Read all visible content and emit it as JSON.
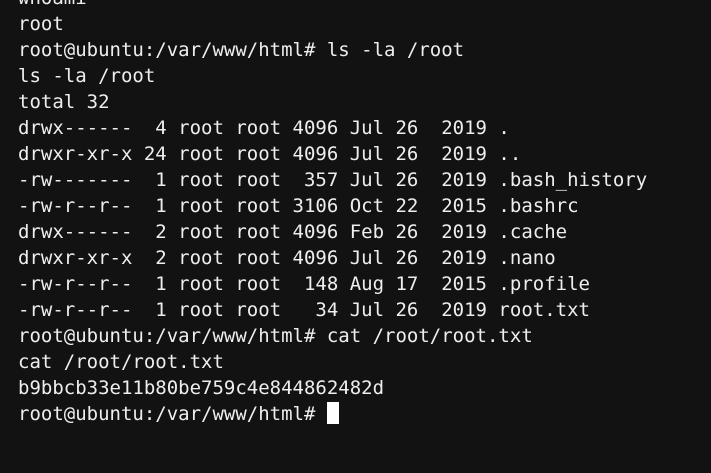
{
  "terminal": {
    "lines": [
      "whoami",
      "root",
      "root@ubuntu:/var/www/html# ls -la /root",
      "ls -la /root",
      "total 32",
      "drwx------  4 root root 4096 Jul 26  2019 .",
      "drwxr-xr-x 24 root root 4096 Jul 26  2019 ..",
      "-rw-------  1 root root  357 Jul 26  2019 .bash_history",
      "-rw-r--r--  1 root root 3106 Oct 22  2015 .bashrc",
      "drwx------  2 root root 4096 Feb 26  2019 .cache",
      "drwxr-xr-x  2 root root 4096 Jul 26  2019 .nano",
      "-rw-r--r--  1 root root  148 Aug 17  2015 .profile",
      "-rw-r--r--  1 root root   34 Jul 26  2019 root.txt",
      "root@ubuntu:/var/www/html# cat /root/root.txt",
      "cat /root/root.txt",
      "b9bbcb33e11b80be759c4e844862482d"
    ],
    "prompt": "root@ubuntu:/var/www/html# "
  }
}
